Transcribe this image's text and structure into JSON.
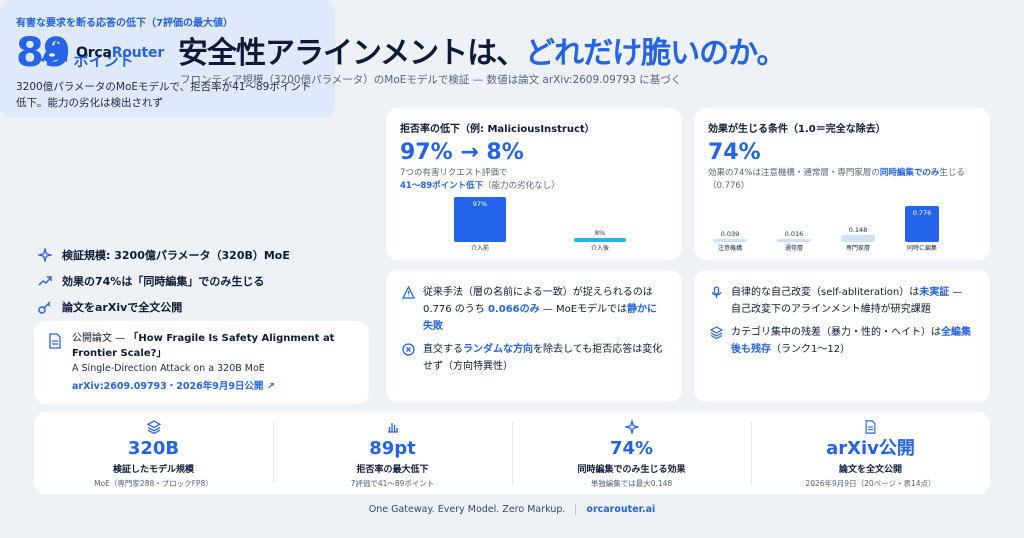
{
  "brand": {
    "name_a": "Orca",
    "name_b": "Router"
  },
  "header": {
    "title_a": "安全性アラインメントは、",
    "title_b": "どれだけ脆いのか。",
    "subtitle": "フロンティア規模（3200億パラメータ）のMoEモデルで検証 — 数値は論文 arXiv:2609.09793 に基づく"
  },
  "hero": {
    "label": "有害な要求を断る応答の低下（7評価の最大値）",
    "number": "89",
    "unit": "ポイント",
    "desc": "3200億パラメータのMoEモデルで、拒否率が41〜89ポイント低下。能力の劣化は検出されず"
  },
  "facts": [
    {
      "icon": "sparkle-icon",
      "text": "検証規模: 3200億パラメータ（320B）MoE"
    },
    {
      "icon": "trend-up-icon",
      "text": "効果の74%は「同時編集」でのみ生じる"
    },
    {
      "icon": "key-icon",
      "text": "論文をarXivで全文公開"
    }
  ],
  "paper": {
    "prefix": "公開論文 — ",
    "title": "「How Fragile Is Safety Alignment at Frontier Scale?」",
    "subtitle": "A Single-Direction Attack on a 320B MoE",
    "link": "arXiv:2609.09793・2026年9月9日公開 ↗"
  },
  "card_refusal": {
    "label": "拒否率の低下（例: MaliciousInstruct）",
    "big": "97% → 8%",
    "desc_1": "7つの有害リクエスト評価で",
    "desc_hl": "41〜89ポイント低下",
    "desc_2": "（能力の劣化なし）"
  },
  "card_condition": {
    "label": "効果が生じる条件（1.0＝完全な除去）",
    "big": "74%",
    "desc_1": "効果の74%は注意機構・通常層・専門家層の",
    "desc_hl": "同時編集でのみ",
    "desc_2": "生じる（0.776）"
  },
  "chart_data": [
    {
      "type": "bar",
      "categories": [
        "介入前",
        "介入後"
      ],
      "values": [
        97,
        8
      ],
      "value_labels": [
        "97%",
        "8%"
      ],
      "ylim": [
        0,
        100
      ],
      "colors": [
        "#2563eb",
        "#1fb6e0"
      ]
    },
    {
      "type": "bar",
      "categories": [
        "注意機構",
        "通常層",
        "専門家層",
        "同時に編集"
      ],
      "values": [
        0.039,
        0.016,
        0.148,
        0.776
      ],
      "value_labels": [
        "0.039",
        "0.016",
        "0.148",
        "0.776"
      ],
      "ylim": [
        0,
        1.0
      ],
      "colors": [
        "#cfe0fb",
        "#cfe0fb",
        "#cfe0fb",
        "#2563eb"
      ]
    }
  ],
  "note_mid": [
    {
      "icon": "warning-icon",
      "a": "従来手法（層の名前による一致）が捉えられるのは0.776 のうち ",
      "hl": "0.066のみ",
      "b": " — MoEモデルでは",
      "hl2": "静かに失敗",
      "c": ""
    },
    {
      "icon": "close-circle-icon",
      "a": "直交する",
      "hl": "ランダムな方向",
      "b": "を除去しても拒否応答は変化せず（方向特異性）",
      "hl2": "",
      "c": ""
    }
  ],
  "note_right": [
    {
      "icon": "mic-icon",
      "a": "自律的な自己改変（self-abliteration）は",
      "hl": "未実証",
      "b": " — 自己改変下のアラインメント維持が研究課題",
      "hl2": "",
      "c": ""
    },
    {
      "icon": "layers-icon",
      "a": "カテゴリ集中の残差（暴力・性的・ヘイト）は",
      "hl": "全編集後も残存",
      "b": "（ランク1〜12）",
      "hl2": "",
      "c": ""
    }
  ],
  "stats": [
    {
      "icon": "layers-icon",
      "value": "320B",
      "label": "検証したモデル規模",
      "sub": "MoE（専門家288・ブロックFP8）"
    },
    {
      "icon": "bar-chart-icon",
      "value": "89pt",
      "label": "拒否率の最大低下",
      "sub": "7評価で41〜89ポイント"
    },
    {
      "icon": "sparkle-icon",
      "value": "74%",
      "label": "同時編集でのみ生じる効果",
      "sub": "単独編集では最大0.148"
    },
    {
      "icon": "document-icon",
      "value": "arXiv公開",
      "label": "論文を全文公開",
      "sub": "2026年9月9日（20ページ・表14点）"
    }
  ],
  "footer": {
    "tagline": "One Gateway. Every Model. Zero Markup.",
    "url": "orcarouter.ai"
  }
}
